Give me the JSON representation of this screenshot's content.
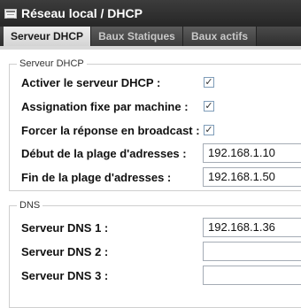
{
  "window": {
    "title": "Réseau local / DHCP",
    "icon": "network-icon"
  },
  "tabs": [
    {
      "label": "Serveur DHCP",
      "active": true
    },
    {
      "label": "Baux Statiques",
      "active": false
    },
    {
      "label": "Baux actifs",
      "active": false
    }
  ],
  "dhcp_server": {
    "legend": "Serveur DHCP",
    "enable_label": "Activer le serveur DHCP :",
    "enable_checked": true,
    "fixed_assignment_label": "Assignation fixe par machine :",
    "fixed_assignment_checked": true,
    "force_broadcast_label": "Forcer la réponse en broadcast :",
    "force_broadcast_checked": true,
    "range_start_label": "Début de la plage d'adresses :",
    "range_start_value": "192.168.1.10",
    "range_end_label": "Fin de la plage d'adresses :",
    "range_end_value": "192.168.1.50"
  },
  "dns": {
    "legend": "DNS",
    "dns1_label": "Serveur DNS 1 :",
    "dns1_value": "192.168.1.36",
    "dns2_label": "Serveur DNS 2 :",
    "dns2_value": "",
    "dns3_label": "Serveur DNS 3 :",
    "dns3_value": ""
  }
}
